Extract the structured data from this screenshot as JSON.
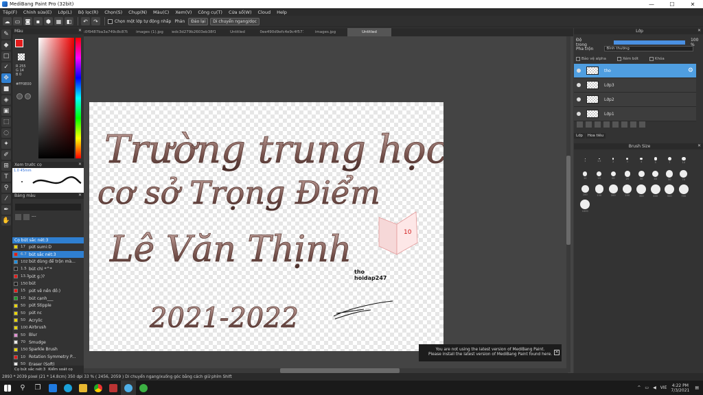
{
  "window": {
    "title": "MediBang Paint Pro (32bit)",
    "btn_min": "—",
    "btn_max": "☐",
    "btn_close": "✕"
  },
  "menu": [
    "Tệp(F)",
    "Chỉnh sửa(E)",
    "Lớp(L)",
    "Bộ lọc(R)",
    "Chọn(S)",
    "Chụp(N)",
    "Màu(C)",
    "Xem(V)",
    "Công cụ(T)",
    "Cửa sổ(W)",
    "Cloud",
    "Help"
  ],
  "toolbar": {
    "check_label": "Chọn một lớp tự động nhấp",
    "flip_label": "Phản",
    "flip_btn": "Đảo lại",
    "move_btn": "Di chuyển ngang/dọc"
  },
  "color_panel": {
    "title": "Màu",
    "r": "R 255",
    "g": "G 14",
    "b": "B 0",
    "hex": "#FF0E00",
    "fg_color": "#e31b1b"
  },
  "brush_preview": {
    "title": "Xem trước cọ",
    "size": "1.0 45mm"
  },
  "palette": {
    "title": "Bảng màu",
    "name": "---"
  },
  "brush_list": {
    "title": "Cọ bút sắc nét:3",
    "items": [
      {
        "size": "17",
        "name": "pứt sumi:D",
        "color": "#e8d400"
      },
      {
        "size": "6.7",
        "name": "bút sắc nét:3",
        "color": "#e31b1b"
      },
      {
        "size": "102",
        "name": "bút dùng để trộn mà...",
        "color": "#1e8fe0"
      },
      {
        "size": "1.5",
        "name": "bút chì *^*",
        "color": "#222222"
      },
      {
        "size": "13.3",
        "name": "pứt g:)?",
        "color": "#e31b1b"
      },
      {
        "size": "150",
        "name": "bút",
        "color": "#222222"
      },
      {
        "size": "15",
        "name": "pứt vẽ nền đồ:)",
        "color": "#e31b1b"
      },
      {
        "size": "10",
        "name": "bút cạnh___",
        "color": "#1e9b2a"
      },
      {
        "size": "50",
        "name": "pứt Stipple",
        "color": "#e8d400"
      },
      {
        "size": "50",
        "name": "pứt nc",
        "color": "#e8d400"
      },
      {
        "size": "50",
        "name": "Acrylic",
        "color": "#e8d400"
      },
      {
        "size": "100",
        "name": "Airbrush",
        "color": "#e8d400"
      },
      {
        "size": "50",
        "name": "Blur",
        "color": "#e090d0"
      },
      {
        "size": "70",
        "name": "Smudge",
        "color": "#e8e8e8"
      },
      {
        "size": "150",
        "name": "Sparkle Brush",
        "color": "#e8d400"
      },
      {
        "size": "10",
        "name": "Rotation Symmetry P...",
        "color": "#e31b1b"
      },
      {
        "size": "50",
        "name": "Eraser (Soft)",
        "color": "#e8e8e8"
      }
    ]
  },
  "left_footer": {
    "tab1": "Cọ bút sắc nét:3",
    "tab2": "Kiểm soát cọ"
  },
  "tabs": [
    "3c0b467c0f9487ba3a749c8c87b2cde.jpg",
    "images (1).jpg",
    "9f3a3a68edc3d279b2603eb38f15307.jpg",
    "Untitled",
    "e90f8d8a0ee490d9efc4e9c4f5772c6e.jpg",
    "images.jpg",
    "Untitled"
  ],
  "artwork": {
    "line1": "Trường trung học",
    "line2": "cơ sở Trọng Điểm",
    "line3": "Lê Văn Thịnh",
    "year": "2021-2022",
    "sig1": "tho",
    "sig2": "hoidap247",
    "book_num": "10"
  },
  "notify": {
    "line1": "You are not using the latest version of MediBang Paint.",
    "line2": "Please install the latest version of MediBang Paint found here.",
    "close": "✕"
  },
  "layer_panel": {
    "title": "Lớp",
    "opacity_label": "Độ trong",
    "opacity_value": "100 %",
    "blend_label": "Pha trộn",
    "blend_value": "Bình thường",
    "protect_label": "Bảo vệ alpha",
    "clip_label": "Xém bớt",
    "lock_label": "Khóa",
    "layers": [
      {
        "name": "tho",
        "selected": true
      },
      {
        "name": "Lớp3",
        "selected": false
      },
      {
        "name": "Lớp2",
        "selected": false
      },
      {
        "name": "Lớp1",
        "selected": false
      }
    ],
    "tab1": "Lớp",
    "tab2": "Hoa tiêu"
  },
  "brush_size_panel": {
    "title": "Brush Size",
    "sizes": [
      "1",
      "1.5",
      "2",
      "3",
      "4",
      "5",
      "7",
      "10",
      "12",
      "15",
      "20",
      "25",
      "30",
      "40",
      "50",
      "70",
      "100",
      "150",
      "200",
      "250",
      "300",
      "400",
      "500",
      "700",
      "1000"
    ]
  },
  "status": "2893 * 2039 pixel  (21 * 14.8cm)  350 dpi  33 %  ( 2456, 2059 )  Di chuyển ngang/xuống góc bằng cách giữ phím Shift",
  "taskbar": {
    "lang": "VIE",
    "time": "4:22 PM",
    "date": "7/3/2021"
  }
}
